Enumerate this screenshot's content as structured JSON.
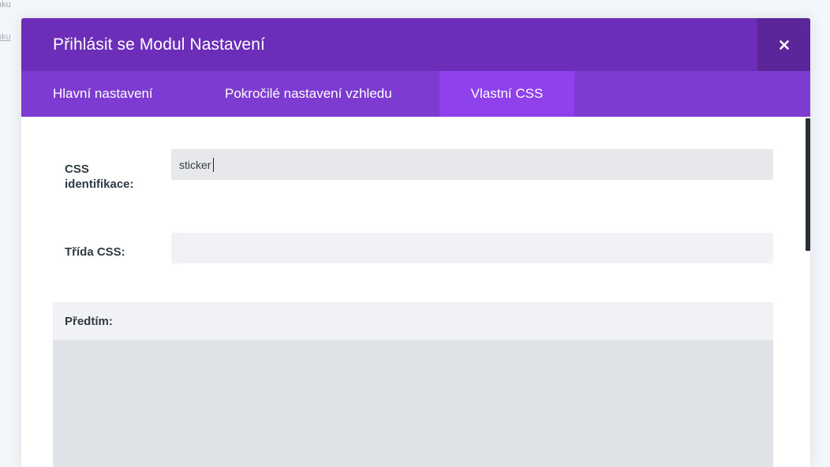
{
  "background": {
    "fragment_top": "nku",
    "fragment_link": "nku"
  },
  "modal": {
    "title": "Přihlásit se Modul Nastavení",
    "close_label": "×",
    "header_color": "#6c2eb9",
    "tab_bar_color": "#7d3bd2",
    "active_tab_color": "#8f42ec"
  },
  "tabs": [
    {
      "label": "Hlavní nastavení",
      "active": false
    },
    {
      "label": "Pokročilé nastavení vzhledu",
      "active": false
    },
    {
      "label": "Vlastní CSS",
      "active": true
    }
  ],
  "fields": {
    "css_id": {
      "label": "CSS identifikace:",
      "value": "sticker"
    },
    "css_class": {
      "label": "Třída CSS:",
      "value": ""
    }
  },
  "before_section": {
    "label": "Předtím:",
    "value": ""
  },
  "icons": {
    "close": "close-icon"
  }
}
